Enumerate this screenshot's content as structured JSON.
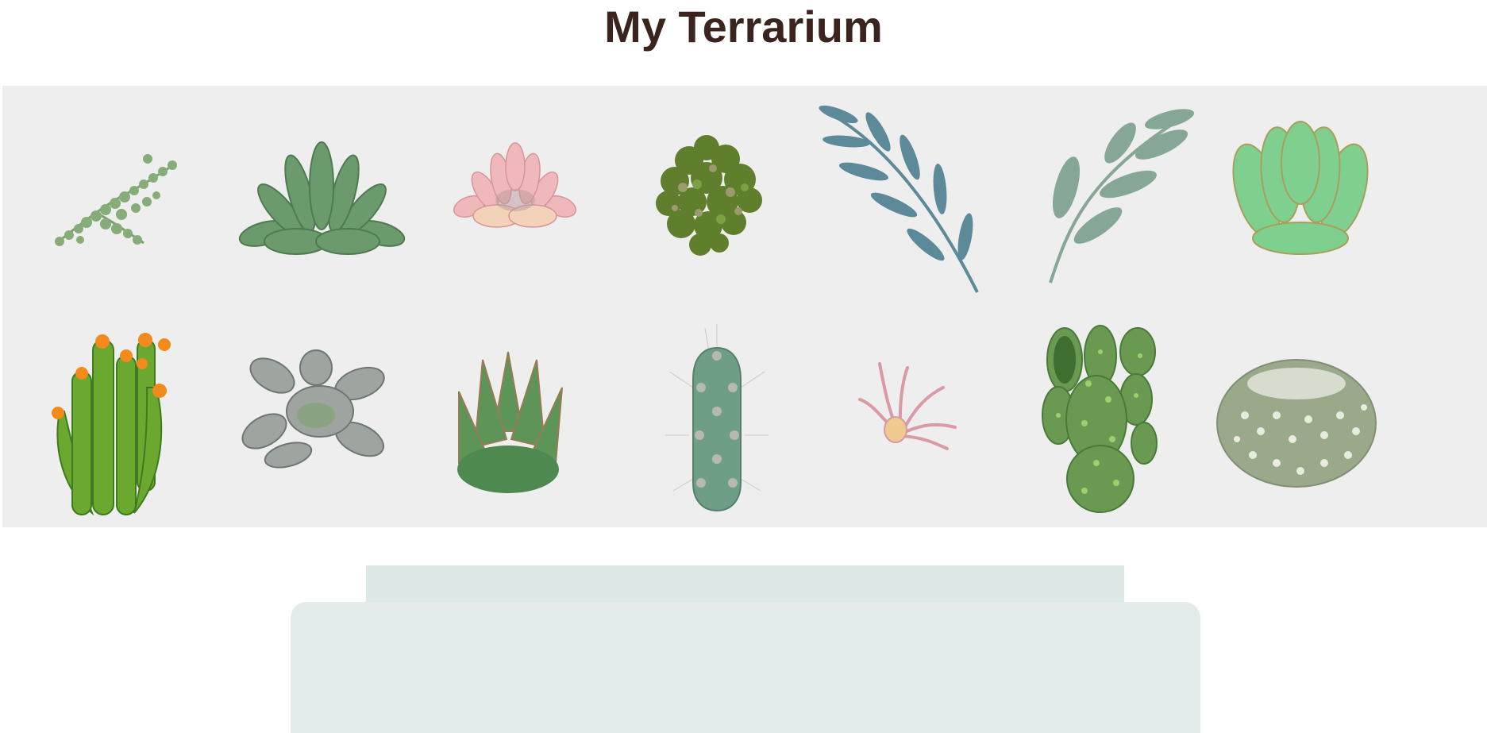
{
  "page": {
    "title": "My Terrarium"
  },
  "plants": [
    {
      "name": "string-of-pearls",
      "icon": "trailing-vine-plant-icon"
    },
    {
      "name": "echeveria-green",
      "icon": "rosette-succulent-icon"
    },
    {
      "name": "pink-echeveria",
      "icon": "pink-succulent-icon"
    },
    {
      "name": "moss-cluster",
      "icon": "leafy-cluster-plant-icon"
    },
    {
      "name": "eucalyptus-branch",
      "icon": "blue-branch-plant-icon"
    },
    {
      "name": "olive-branch",
      "icon": "sage-branch-plant-icon"
    },
    {
      "name": "jade-rosette",
      "icon": "mint-succulent-icon"
    },
    {
      "name": "flowering-finger-cactus",
      "icon": "orange-flower-cactus-icon"
    },
    {
      "name": "grey-star-succulent",
      "icon": "grey-succulent-icon"
    },
    {
      "name": "agave",
      "icon": "agave-succulent-icon"
    },
    {
      "name": "column-cactus",
      "icon": "columnar-cactus-icon"
    },
    {
      "name": "air-plant",
      "icon": "air-plant-icon"
    },
    {
      "name": "prickly-pear-cactus",
      "icon": "prickly-pear-cactus-icon"
    },
    {
      "name": "ball-cactus",
      "icon": "ball-cactus-icon"
    }
  ],
  "colors": {
    "title": "#3a241d",
    "tray": "#eeeeee",
    "jar_lid": "#dde9e7",
    "jar_body": "#e4eceb"
  }
}
